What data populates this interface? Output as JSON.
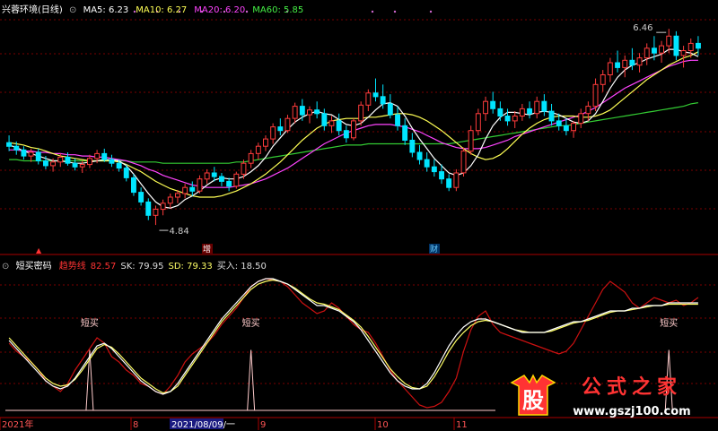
{
  "header": {
    "symbol": "兴蓉环境(日线)",
    "ma": [
      {
        "label": "MA5:",
        "value": "6.23",
        "color": "#ffffff"
      },
      {
        "label": "MA10:",
        "value": "6.27",
        "color": "#ffff55"
      },
      {
        "label": "MA20:",
        "value": "6.20",
        "color": "#ff44ff"
      },
      {
        "label": "MA60:",
        "value": "5.85",
        "color": "#44ee44"
      }
    ]
  },
  "indicator": {
    "name": "短买密码",
    "fields": [
      {
        "label": "趋势线",
        "value": "",
        "color": "#ff3333"
      },
      {
        "label": "",
        "value": "82.57",
        "color": "#ff3333"
      },
      {
        "label": "SK:",
        "value": "79.95",
        "color": "#dddddd"
      },
      {
        "label": "SD:",
        "value": "79.33",
        "color": "#ffff66"
      },
      {
        "label": "买入:",
        "value": "18.50",
        "color": "#dddddd"
      }
    ],
    "signal_text": "短买"
  },
  "markers": {
    "zeng": "增",
    "cai": "财",
    "high_label": "6.46",
    "low_label": "4.84"
  },
  "xaxis": {
    "labels": [
      "2021年",
      "8",
      "2021/08/09/一",
      "9",
      "10",
      "11"
    ]
  },
  "watermark": {
    "icon_char": "股",
    "title": "公式之家",
    "url": "www.gszj100.com"
  },
  "colors": {
    "up": "#ff3c3c",
    "down": "#00e5ff",
    "ma5": "#ffffff",
    "ma10": "#ffff55",
    "ma20": "#ff44ff",
    "ma60": "#33cc33",
    "trend": "#cc1111",
    "sk": "#ffffff",
    "sd": "#ffff66",
    "grid": "#7a0000"
  },
  "chart_data": [
    {
      "type": "candlestick",
      "price_range": [
        4.7,
        6.55
      ],
      "highest_marker": 6.46,
      "lowest_marker": 4.84,
      "candles": [
        [
          5.52,
          5.58,
          5.45,
          5.49
        ],
        [
          5.49,
          5.53,
          5.42,
          5.46
        ],
        [
          5.46,
          5.49,
          5.38,
          5.41
        ],
        [
          5.41,
          5.47,
          5.36,
          5.44
        ],
        [
          5.44,
          5.47,
          5.34,
          5.37
        ],
        [
          5.37,
          5.41,
          5.3,
          5.33
        ],
        [
          5.33,
          5.39,
          5.28,
          5.36
        ],
        [
          5.36,
          5.43,
          5.32,
          5.4
        ],
        [
          5.4,
          5.44,
          5.33,
          5.35
        ],
        [
          5.35,
          5.39,
          5.29,
          5.32
        ],
        [
          5.32,
          5.37,
          5.27,
          5.34
        ],
        [
          5.34,
          5.42,
          5.31,
          5.39
        ],
        [
          5.39,
          5.46,
          5.35,
          5.43
        ],
        [
          5.43,
          5.47,
          5.36,
          5.38
        ],
        [
          5.38,
          5.42,
          5.32,
          5.35
        ],
        [
          5.35,
          5.38,
          5.28,
          5.31
        ],
        [
          5.31,
          5.34,
          5.2,
          5.23
        ],
        [
          5.23,
          5.26,
          5.08,
          5.11
        ],
        [
          5.11,
          5.15,
          5.0,
          5.03
        ],
        [
          5.03,
          5.06,
          4.88,
          4.92
        ],
        [
          4.92,
          5.0,
          4.84,
          4.97
        ],
        [
          4.97,
          5.05,
          4.92,
          5.02
        ],
        [
          5.02,
          5.1,
          4.98,
          5.07
        ],
        [
          5.07,
          5.13,
          5.02,
          5.1
        ],
        [
          5.1,
          5.18,
          5.06,
          5.15
        ],
        [
          5.15,
          5.2,
          5.08,
          5.12
        ],
        [
          5.12,
          5.25,
          5.1,
          5.22
        ],
        [
          5.22,
          5.3,
          5.18,
          5.27
        ],
        [
          5.27,
          5.32,
          5.2,
          5.24
        ],
        [
          5.24,
          5.27,
          5.16,
          5.2
        ],
        [
          5.2,
          5.23,
          5.12,
          5.16
        ],
        [
          5.16,
          5.28,
          5.14,
          5.26
        ],
        [
          5.26,
          5.38,
          5.22,
          5.35
        ],
        [
          5.35,
          5.46,
          5.31,
          5.43
        ],
        [
          5.43,
          5.52,
          5.38,
          5.49
        ],
        [
          5.49,
          5.58,
          5.45,
          5.55
        ],
        [
          5.55,
          5.68,
          5.51,
          5.65
        ],
        [
          5.65,
          5.72,
          5.58,
          5.62
        ],
        [
          5.62,
          5.75,
          5.6,
          5.72
        ],
        [
          5.72,
          5.85,
          5.68,
          5.82
        ],
        [
          5.82,
          5.88,
          5.7,
          5.75
        ],
        [
          5.75,
          5.82,
          5.68,
          5.79
        ],
        [
          5.79,
          5.86,
          5.72,
          5.76
        ],
        [
          5.76,
          5.8,
          5.62,
          5.66
        ],
        [
          5.66,
          5.74,
          5.6,
          5.7
        ],
        [
          5.7,
          5.76,
          5.58,
          5.62
        ],
        [
          5.62,
          5.66,
          5.52,
          5.56
        ],
        [
          5.56,
          5.72,
          5.54,
          5.7
        ],
        [
          5.7,
          5.86,
          5.66,
          5.83
        ],
        [
          5.83,
          5.96,
          5.78,
          5.93
        ],
        [
          5.93,
          6.05,
          5.86,
          5.9
        ],
        [
          5.9,
          6.0,
          5.8,
          5.84
        ],
        [
          5.84,
          5.92,
          5.72,
          5.75
        ],
        [
          5.75,
          5.82,
          5.62,
          5.66
        ],
        [
          5.66,
          5.72,
          5.5,
          5.54
        ],
        [
          5.54,
          5.6,
          5.4,
          5.44
        ],
        [
          5.44,
          5.5,
          5.34,
          5.38
        ],
        [
          5.38,
          5.44,
          5.28,
          5.32
        ],
        [
          5.32,
          5.38,
          5.24,
          5.28
        ],
        [
          5.28,
          5.34,
          5.18,
          5.22
        ],
        [
          5.22,
          5.26,
          5.12,
          5.15
        ],
        [
          5.15,
          5.3,
          5.12,
          5.27
        ],
        [
          5.27,
          5.48,
          5.24,
          5.45
        ],
        [
          5.45,
          5.66,
          5.42,
          5.62
        ],
        [
          5.62,
          5.8,
          5.58,
          5.76
        ],
        [
          5.76,
          5.9,
          5.7,
          5.86
        ],
        [
          5.86,
          5.94,
          5.76,
          5.8
        ],
        [
          5.8,
          5.86,
          5.7,
          5.74
        ],
        [
          5.74,
          5.8,
          5.66,
          5.7
        ],
        [
          5.7,
          5.78,
          5.64,
          5.74
        ],
        [
          5.74,
          5.84,
          5.7,
          5.8
        ],
        [
          5.8,
          5.86,
          5.72,
          5.76
        ],
        [
          5.76,
          5.9,
          5.72,
          5.86
        ],
        [
          5.86,
          5.92,
          5.74,
          5.78
        ],
        [
          5.78,
          5.84,
          5.66,
          5.7
        ],
        [
          5.7,
          5.76,
          5.62,
          5.66
        ],
        [
          5.66,
          5.72,
          5.58,
          5.62
        ],
        [
          5.62,
          5.7,
          5.56,
          5.68
        ],
        [
          5.68,
          5.8,
          5.64,
          5.76
        ],
        [
          5.76,
          5.86,
          5.7,
          5.82
        ],
        [
          5.82,
          6.05,
          5.78,
          6.0
        ],
        [
          6.0,
          6.12,
          5.94,
          6.08
        ],
        [
          6.08,
          6.22,
          6.02,
          6.18
        ],
        [
          6.18,
          6.28,
          6.1,
          6.14
        ],
        [
          6.14,
          6.24,
          6.06,
          6.2
        ],
        [
          6.2,
          6.3,
          6.12,
          6.16
        ],
        [
          6.16,
          6.26,
          6.1,
          6.22
        ],
        [
          6.22,
          6.34,
          6.16,
          6.3
        ],
        [
          6.3,
          6.4,
          6.2,
          6.26
        ],
        [
          6.26,
          6.36,
          6.18,
          6.32
        ],
        [
          6.32,
          6.46,
          6.26,
          6.4
        ],
        [
          6.4,
          6.44,
          6.2,
          6.24
        ],
        [
          6.24,
          6.32,
          6.14,
          6.28
        ],
        [
          6.28,
          6.38,
          6.22,
          6.34
        ],
        [
          6.34,
          6.4,
          6.24,
          6.3
        ]
      ],
      "ma5": [
        5.5,
        5.48,
        5.45,
        5.43,
        5.41,
        5.39,
        5.37,
        5.37,
        5.36,
        5.35,
        5.35,
        5.36,
        5.37,
        5.38,
        5.38,
        5.37,
        5.33,
        5.26,
        5.18,
        5.1,
        5.03,
        4.99,
        4.98,
        5.0,
        5.05,
        5.08,
        5.12,
        5.17,
        5.21,
        5.23,
        5.22,
        5.22,
        5.24,
        5.28,
        5.33,
        5.4,
        5.49,
        5.56,
        5.63,
        5.69,
        5.73,
        5.76,
        5.78,
        5.76,
        5.75,
        5.71,
        5.67,
        5.66,
        5.68,
        5.73,
        5.79,
        5.84,
        5.85,
        5.82,
        5.74,
        5.64,
        5.55,
        5.47,
        5.39,
        5.33,
        5.27,
        5.25,
        5.27,
        5.33,
        5.42,
        5.55,
        5.66,
        5.73,
        5.77,
        5.77,
        5.76,
        5.75,
        5.77,
        5.78,
        5.77,
        5.75,
        5.72,
        5.69,
        5.68,
        5.7,
        5.76,
        5.86,
        5.97,
        6.06,
        6.12,
        6.16,
        6.18,
        6.21,
        6.23,
        6.25,
        6.29,
        6.29,
        6.27,
        6.26,
        6.23
      ],
      "ma10": [
        5.52,
        5.51,
        5.5,
        5.48,
        5.47,
        5.45,
        5.43,
        5.41,
        5.4,
        5.39,
        5.38,
        5.37,
        5.37,
        5.37,
        5.37,
        5.36,
        5.34,
        5.31,
        5.28,
        5.24,
        5.2,
        5.17,
        5.14,
        5.12,
        5.1,
        5.08,
        5.07,
        5.07,
        5.07,
        5.08,
        5.1,
        5.12,
        5.15,
        5.18,
        5.22,
        5.26,
        5.31,
        5.36,
        5.42,
        5.48,
        5.54,
        5.59,
        5.64,
        5.67,
        5.7,
        5.71,
        5.72,
        5.72,
        5.72,
        5.73,
        5.73,
        5.74,
        5.75,
        5.76,
        5.76,
        5.75,
        5.73,
        5.7,
        5.66,
        5.62,
        5.57,
        5.52,
        5.47,
        5.43,
        5.4,
        5.38,
        5.39,
        5.42,
        5.47,
        5.53,
        5.59,
        5.64,
        5.68,
        5.71,
        5.73,
        5.74,
        5.74,
        5.74,
        5.73,
        5.73,
        5.74,
        5.76,
        5.79,
        5.84,
        5.89,
        5.94,
        5.99,
        6.04,
        6.08,
        6.12,
        6.16,
        6.19,
        6.22,
        6.24,
        6.27
      ],
      "ma20": [
        5.46,
        5.46,
        5.45,
        5.45,
        5.44,
        5.44,
        5.43,
        5.43,
        5.42,
        5.42,
        5.41,
        5.41,
        5.4,
        5.4,
        5.39,
        5.38,
        5.37,
        5.35,
        5.33,
        5.3,
        5.28,
        5.25,
        5.23,
        5.21,
        5.19,
        5.17,
        5.16,
        5.15,
        5.15,
        5.15,
        5.15,
        5.16,
        5.17,
        5.18,
        5.2,
        5.22,
        5.25,
        5.28,
        5.31,
        5.35,
        5.39,
        5.43,
        5.47,
        5.51,
        5.54,
        5.57,
        5.6,
        5.62,
        5.64,
        5.66,
        5.67,
        5.67,
        5.67,
        5.66,
        5.65,
        5.63,
        5.61,
        5.58,
        5.55,
        5.52,
        5.5,
        5.48,
        5.47,
        5.47,
        5.47,
        5.48,
        5.5,
        5.52,
        5.54,
        5.57,
        5.59,
        5.61,
        5.63,
        5.65,
        5.67,
        5.69,
        5.71,
        5.73,
        5.75,
        5.78,
        5.81,
        5.85,
        5.89,
        5.93,
        5.97,
        6.0,
        6.03,
        6.06,
        6.09,
        6.12,
        6.15,
        6.17,
        6.19,
        6.2,
        6.2
      ],
      "ma60": [
        5.38,
        5.38,
        5.37,
        5.37,
        5.37,
        5.37,
        5.37,
        5.37,
        5.37,
        5.37,
        5.37,
        5.37,
        5.37,
        5.37,
        5.37,
        5.37,
        5.37,
        5.36,
        5.36,
        5.36,
        5.36,
        5.35,
        5.35,
        5.35,
        5.35,
        5.35,
        5.35,
        5.35,
        5.35,
        5.35,
        5.35,
        5.36,
        5.36,
        5.37,
        5.38,
        5.39,
        5.4,
        5.41,
        5.42,
        5.43,
        5.44,
        5.45,
        5.46,
        5.47,
        5.48,
        5.49,
        5.5,
        5.5,
        5.5,
        5.51,
        5.51,
        5.51,
        5.51,
        5.51,
        5.51,
        5.51,
        5.51,
        5.51,
        5.51,
        5.51,
        5.51,
        5.52,
        5.53,
        5.54,
        5.55,
        5.56,
        5.57,
        5.58,
        5.59,
        5.6,
        5.61,
        5.62,
        5.63,
        5.64,
        5.65,
        5.66,
        5.66,
        5.67,
        5.68,
        5.69,
        5.7,
        5.71,
        5.72,
        5.73,
        5.74,
        5.75,
        5.76,
        5.77,
        5.78,
        5.79,
        5.8,
        5.81,
        5.82,
        5.84,
        5.85
      ]
    },
    {
      "type": "line",
      "y_range": [
        0,
        100
      ],
      "trend": [
        50,
        44,
        40,
        36,
        30,
        22,
        18,
        14,
        20,
        30,
        38,
        46,
        54,
        50,
        40,
        36,
        30,
        26,
        20,
        18,
        14,
        12,
        18,
        26,
        36,
        42,
        46,
        50,
        56,
        64,
        70,
        76,
        84,
        92,
        96,
        98,
        97,
        96,
        92,
        86,
        80,
        76,
        72,
        74,
        80,
        76,
        70,
        64,
        60,
        58,
        50,
        40,
        30,
        22,
        16,
        10,
        4,
        2,
        3,
        6,
        14,
        24,
        44,
        60,
        70,
        74,
        64,
        58,
        56,
        54,
        52,
        50,
        48,
        46,
        44,
        42,
        44,
        50,
        60,
        70,
        80,
        90,
        96,
        92,
        88,
        80,
        76,
        80,
        84,
        82,
        80,
        82,
        78,
        80,
        84
      ],
      "sk": [
        52,
        46,
        40,
        34,
        28,
        22,
        18,
        16,
        18,
        24,
        32,
        40,
        48,
        50,
        46,
        40,
        34,
        28,
        22,
        18,
        14,
        12,
        14,
        20,
        28,
        36,
        44,
        52,
        60,
        68,
        74,
        80,
        86,
        92,
        96,
        98,
        98,
        96,
        94,
        90,
        86,
        82,
        78,
        78,
        76,
        74,
        70,
        66,
        60,
        52,
        44,
        36,
        28,
        22,
        18,
        16,
        16,
        20,
        28,
        38,
        48,
        56,
        62,
        66,
        68,
        68,
        66,
        64,
        62,
        60,
        58,
        58,
        58,
        58,
        60,
        62,
        64,
        66,
        66,
        68,
        70,
        72,
        74,
        74,
        74,
        76,
        76,
        78,
        78,
        78,
        80,
        80,
        80,
        80,
        80
      ],
      "sd": [
        54,
        48,
        42,
        36,
        30,
        24,
        20,
        18,
        19,
        23,
        30,
        38,
        46,
        49,
        47,
        42,
        36,
        30,
        24,
        20,
        16,
        13,
        14,
        18,
        26,
        34,
        42,
        50,
        58,
        66,
        72,
        78,
        84,
        90,
        94,
        96,
        97,
        96,
        94,
        91,
        87,
        83,
        80,
        79,
        77,
        75,
        71,
        67,
        62,
        55,
        47,
        39,
        31,
        25,
        20,
        17,
        16,
        18,
        25,
        34,
        44,
        52,
        58,
        63,
        66,
        67,
        66,
        64,
        62,
        60,
        59,
        58,
        58,
        58,
        59,
        61,
        63,
        65,
        66,
        67,
        69,
        71,
        73,
        74,
        74,
        75,
        76,
        77,
        78,
        78,
        79,
        79,
        79,
        79,
        79
      ],
      "buy_spikes": [
        [
          11,
          45
        ],
        [
          33,
          45
        ],
        [
          90,
          45
        ]
      ],
      "buy_labels_idx": [
        11,
        33,
        90
      ]
    }
  ]
}
